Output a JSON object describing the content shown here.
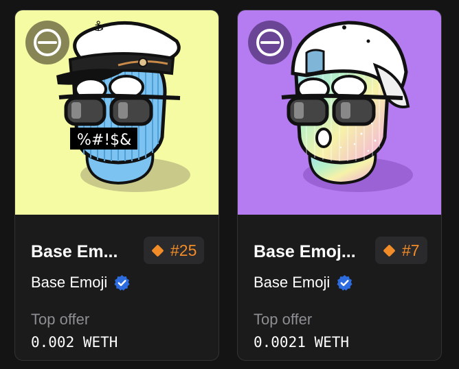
{
  "cards": [
    {
      "title": "Base Em...",
      "rank": "#25",
      "collection": "Base Emoji",
      "offer_label": "Top offer",
      "offer_value": "0.002 WETH",
      "mask_text": "%#!$&",
      "bg_color": "#f4fba3"
    },
    {
      "title": "Base Emoj...",
      "rank": "#7",
      "collection": "Base Emoji",
      "offer_label": "Top offer",
      "offer_value": "0.0021 WETH",
      "bg_color": "#b57bf0"
    }
  ],
  "colors": {
    "accent": "#f28c28",
    "verified": "#2d6cdf",
    "muted": "#8e8e93"
  }
}
